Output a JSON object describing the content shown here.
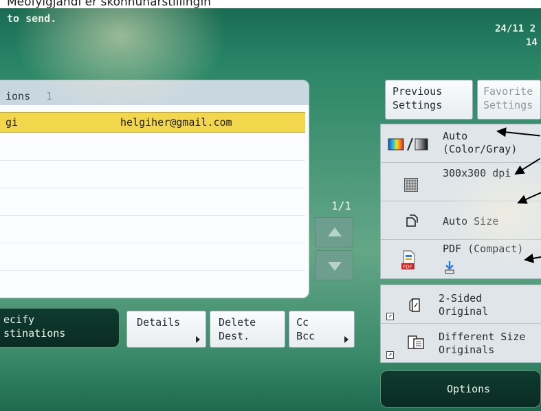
{
  "top_caption": "Meðfylgjandi er skönnunarstillingin",
  "status": {
    "message": "to send.",
    "date": "24/11 2",
    "time": "14"
  },
  "destinations": {
    "header_label": "ions",
    "header_count": "1",
    "rows": [
      {
        "name": "gi",
        "email": "helgiher@gmail.com"
      }
    ]
  },
  "pager": {
    "page_indicator": "1/1",
    "up_icon": "triangle-up-icon",
    "down_icon": "triangle-down-icon"
  },
  "actions": {
    "specify_label": "ecify\nstinations",
    "details_label": "Details",
    "delete_label": "Delete\nDest.",
    "ccbcc_label": "Cc\nBcc"
  },
  "quick_settings": {
    "previous_label": "Previous\nSettings",
    "favorite_label": "Favorite\nSettings"
  },
  "scan_settings": {
    "color_mode": "Auto\n(Color/Gray)",
    "resolution": "300x300 dpi",
    "scan_size": "Auto Size",
    "file_type": "PDF (Compact)"
  },
  "original_settings": {
    "sides": "2-Sided\nOriginal",
    "mixed_size": "Different Size\nOriginals"
  },
  "options_label": "Options",
  "colors": {
    "panel_green": "#2a8566",
    "selected_row": "#f2d64b",
    "dark_button": "#0f3b2f"
  }
}
